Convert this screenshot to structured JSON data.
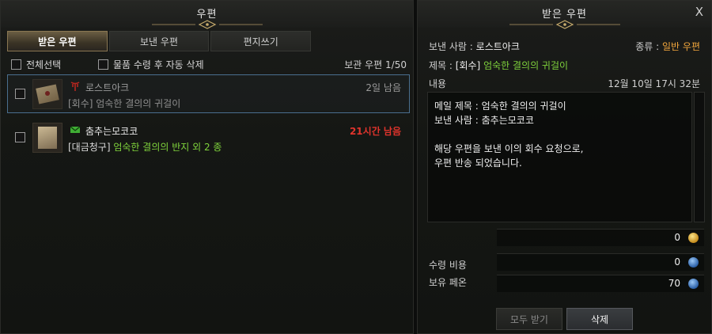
{
  "left": {
    "title": "우편",
    "tabs": [
      {
        "label": "받은 우편",
        "active": true
      },
      {
        "label": "보낸 우편",
        "active": false
      },
      {
        "label": "편지쓰기",
        "active": false
      }
    ],
    "select_all": "전체선택",
    "auto_delete": "물품 수령 후 자동 삭제",
    "storage": "보관 우편 1/50",
    "mails": [
      {
        "sender": "로스트아크",
        "tag": "[회수]",
        "subject": " 엄숙한 결의의 귀걸이",
        "time": "2일 남음",
        "selected": true
      },
      {
        "sender": "춤추는모코코",
        "tag": "[대금청구]",
        "subject": " 엄숙한 결의의 반지 외 2 종",
        "time": "21시간 남음",
        "selected": false
      }
    ]
  },
  "right": {
    "title": "받은 우편",
    "close": "X",
    "sender_label": "보낸 사람 :",
    "sender_value": "로스트아크",
    "kind_label": "종류 :",
    "kind_value": "일반 우편",
    "subject_label": "제목 :",
    "subject_tag": "[회수]",
    "subject_value": "엄숙한 결의의 귀걸이",
    "content_label": "내용",
    "date": "12월 10일 17시 32분",
    "content_lines": [
      "메일 제목 : 엄숙한 결의의 귀걸이",
      "보낸 사람 : 춤추는모코코",
      "",
      "해당 우편을 보낸 이의 회수 요청으로,",
      "우편 반송 되었습니다."
    ],
    "gold_value": "0",
    "fee_label": "수령 비용",
    "fee_value": "0",
    "owned_label": "보유 페온",
    "owned_value": "70",
    "btn_receive_all": "모두 받기",
    "btn_delete": "삭제"
  },
  "colors": {
    "accent_green": "#7fd33c",
    "urgent_red": "#e0342c",
    "kind_orange": "#f0a53c"
  },
  "icons": [
    "ornament-icon",
    "close-icon",
    "checkbox-icon",
    "envelope-icon",
    "lostark-logo-icon",
    "mail-green-icon",
    "gold-coin-icon",
    "pheon-icon"
  ]
}
